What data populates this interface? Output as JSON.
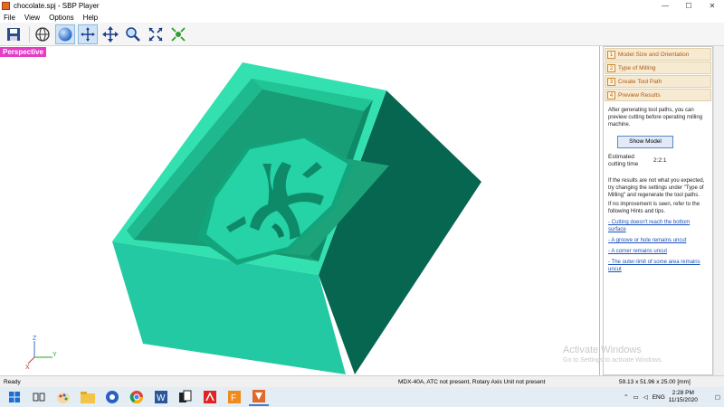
{
  "window": {
    "title": "chocolate.spj - SBP Player",
    "controls": [
      "—",
      "☐",
      "✕"
    ]
  },
  "menu": [
    "File",
    "View",
    "Options",
    "Help"
  ],
  "toolbar": {
    "buttons": [
      "save-icon",
      "globe-icon",
      "sphere-icon",
      "rotate-icon",
      "pan-icon",
      "zoom-icon",
      "fit-icon",
      "extents-icon"
    ]
  },
  "viewport": {
    "view_label": "Perspective",
    "axis_labels": [
      "Z",
      "Y",
      "X"
    ],
    "colors": {
      "top": "#2dd9a7",
      "inner": "#1ea882",
      "front": "#23c9a2",
      "side": "#06664f",
      "cavity": "#17996f"
    }
  },
  "panel": {
    "steps": [
      {
        "num": "1",
        "label": "Model Size and Orientation"
      },
      {
        "num": "2",
        "label": "Type of Milling"
      },
      {
        "num": "3",
        "label": "Create Tool Path"
      },
      {
        "num": "4",
        "label": "Preview Results"
      }
    ],
    "intro": "After generating tool paths, you can preview cutting before operating milling machine.",
    "show_model_button": "Show Model",
    "estimated_label": "Estimated cutting time",
    "estimated_value": "2:2:1",
    "note1": "If the results are not what you expected, try changing the settings under \"Type of Milling\" and regenerate the tool paths.",
    "note2": "If no improvement is seen, refer to the following Hints and tips.",
    "links": [
      "- Cutting doesn't reach the bottom surface",
      "- A groove or hole remains uncut",
      "- A corner remains uncut",
      "- The outer-limit of some area remains uncut"
    ]
  },
  "watermark": {
    "line1": "Activate Windows",
    "line2": "Go to Settings to activate Windows."
  },
  "status": {
    "left": "Ready",
    "middle": "MDX-40A, ATC not present, Rotary Axis Unit not present",
    "right": "59.13 x 51.96 x 25.00 [mm]"
  },
  "taskbar": {
    "icons": [
      "windows-icon",
      "task-view-icon",
      "paint-icon",
      "file-explorer-icon",
      "chrome-alt-icon",
      "chrome-icon",
      "word-icon",
      "cards-icon",
      "acrobat-icon",
      "sbp-f-icon",
      "sbp-player-icon"
    ],
    "language": "ENG",
    "time": "2:28 PM",
    "date": "11/15/2020"
  }
}
